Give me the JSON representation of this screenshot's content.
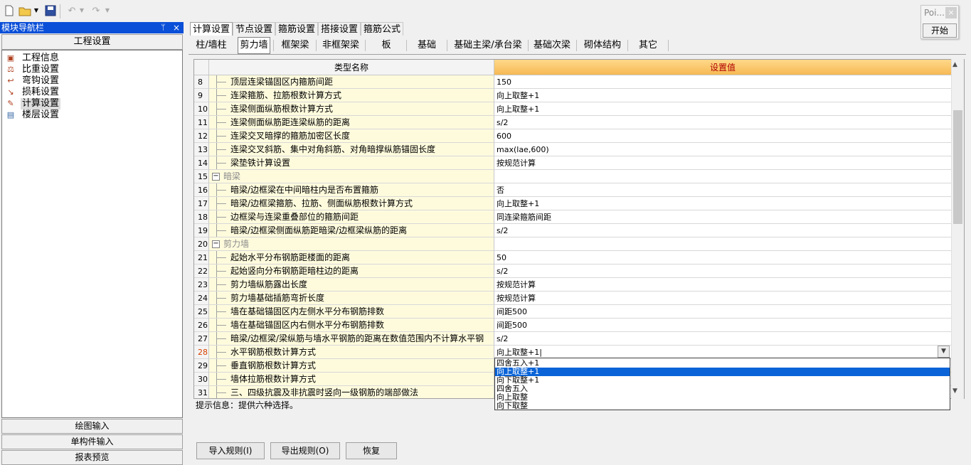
{
  "toolbar": {
    "icons": [
      "new-file-icon",
      "open-folder-icon",
      "dropdown-icon",
      "save-icon",
      "undo-icon",
      "dropdown-icon",
      "redo-icon",
      "dropdown-icon"
    ]
  },
  "floating": {
    "title": "Poi...",
    "close": "×",
    "start_label": "开始"
  },
  "nav": {
    "title": "模块导航栏",
    "pin": "ᛘ",
    "close": "×",
    "section": "工程设置",
    "items": [
      {
        "label": "工程信息",
        "icon": "project-info-icon"
      },
      {
        "label": "比重设置",
        "icon": "weight-settings-icon"
      },
      {
        "label": "弯钩设置",
        "icon": "hook-settings-icon"
      },
      {
        "label": "损耗设置",
        "icon": "loss-settings-icon"
      },
      {
        "label": "计算设置",
        "icon": "calc-settings-icon"
      },
      {
        "label": "楼层设置",
        "icon": "floor-settings-icon"
      }
    ],
    "buttons": [
      "绘图输入",
      "单构件输入",
      "报表预览"
    ]
  },
  "tabs": [
    "计算设置",
    "节点设置",
    "箍筋设置",
    "搭接设置",
    "箍筋公式"
  ],
  "subtabs": [
    "柱/墙柱",
    "剪力墙",
    "框架梁",
    "非框架梁",
    "板",
    "基础",
    "基础主梁/承台梁",
    "基础次梁",
    "砌体结构",
    "其它"
  ],
  "grid": {
    "header_name": "类型名称",
    "header_value": "设置值",
    "rows": [
      {
        "num": "8",
        "name": "顶层连梁锚固区内箍筋间距",
        "value": "150"
      },
      {
        "num": "9",
        "name": "连梁箍筋、拉筋根数计算方式",
        "value": "向上取整+1"
      },
      {
        "num": "10",
        "name": "连梁侧面纵筋根数计算方式",
        "value": "向上取整+1"
      },
      {
        "num": "11",
        "name": "连梁侧面纵筋距连梁纵筋的距离",
        "value": "s/2"
      },
      {
        "num": "12",
        "name": "连梁交叉暗撑的箍筋加密区长度",
        "value": "600"
      },
      {
        "num": "13",
        "name": "连梁交叉斜筋、集中对角斜筋、对角暗撑纵筋锚固长度",
        "value": "max(lae,600)"
      },
      {
        "num": "14",
        "name": "梁垫铁计算设置",
        "value": "按规范计算"
      },
      {
        "num": "15",
        "name": "暗梁",
        "value": "",
        "group": true
      },
      {
        "num": "16",
        "name": "暗梁/边框梁在中间暗柱内是否布置箍筋",
        "value": "否"
      },
      {
        "num": "17",
        "name": "暗梁/边框梁箍筋、拉筋、侧面纵筋根数计算方式",
        "value": "向上取整+1"
      },
      {
        "num": "18",
        "name": "边框梁与连梁重叠部位的箍筋间距",
        "value": "同连梁箍筋间距"
      },
      {
        "num": "19",
        "name": "暗梁/边框梁侧面纵筋距暗梁/边框梁纵筋的距离",
        "value": "s/2"
      },
      {
        "num": "20",
        "name": "剪力墙",
        "value": "",
        "group": true
      },
      {
        "num": "21",
        "name": "起始水平分布钢筋距楼面的距离",
        "value": "50"
      },
      {
        "num": "22",
        "name": "起始竖向分布钢筋距暗柱边的距离",
        "value": "s/2"
      },
      {
        "num": "23",
        "name": "剪力墙纵筋露出长度",
        "value": "按规范计算"
      },
      {
        "num": "24",
        "name": "剪力墙基础插筋弯折长度",
        "value": "按规范计算"
      },
      {
        "num": "25",
        "name": "墙在基础锚固区内左侧水平分布钢筋排数",
        "value": "间距500"
      },
      {
        "num": "26",
        "name": "墙在基础锚固区内右侧水平分布钢筋排数",
        "value": "间距500"
      },
      {
        "num": "27",
        "name": "暗梁/边框梁/梁纵筋与墙水平钢筋的距离在数值范围内不计算水平钢",
        "value": "s/2"
      },
      {
        "num": "28",
        "name": "水平钢筋根数计算方式",
        "value": "向上取整+1|",
        "current": true
      },
      {
        "num": "29",
        "name": "垂直钢筋根数计算方式",
        "value": ""
      },
      {
        "num": "30",
        "name": "墙体拉筋根数计算方式",
        "value": ""
      },
      {
        "num": "31",
        "name": "三、四级抗震及非抗震时竖向一级钢筋的端部做法",
        "value": ""
      }
    ]
  },
  "dropdown": {
    "options": [
      "四舍五入+1",
      "向上取整+1",
      "向下取整+1",
      "四舍五入",
      "向上取整",
      "向下取整"
    ],
    "selected_index": 1
  },
  "hint": "提示信息：提供六种选择。",
  "bottom_buttons": [
    "导入规则(I)",
    "导出规则(O)",
    "恢复"
  ]
}
